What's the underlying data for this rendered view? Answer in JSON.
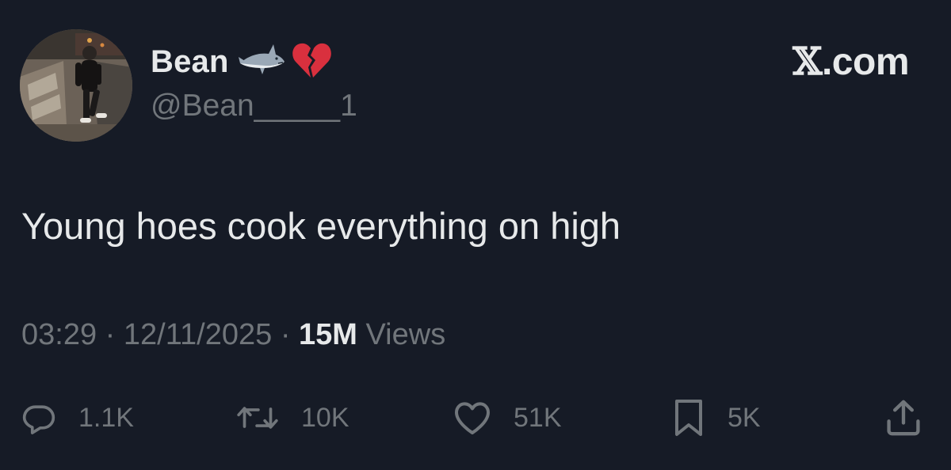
{
  "author": {
    "display_name": "Bean",
    "emojis": [
      "shark-emoji",
      "broken-heart-emoji"
    ],
    "handle": "@Bean_____1"
  },
  "brand": {
    "glyph": "𝕏",
    "suffix": ".com"
  },
  "tweet": {
    "text": "Young hoes cook everything on high"
  },
  "meta": {
    "time": "03:29",
    "date": "12/11/2025",
    "separator": "·",
    "views_count": "15M",
    "views_label": "Views"
  },
  "actions": {
    "reply": {
      "icon": "reply-icon",
      "count": "1.1K"
    },
    "repost": {
      "icon": "repost-icon",
      "count": "10K"
    },
    "like": {
      "icon": "heart-icon",
      "count": "51K"
    },
    "bookmark": {
      "icon": "bookmark-icon",
      "count": "5K"
    },
    "share": {
      "icon": "share-icon"
    }
  },
  "colors": {
    "background": "#161b26",
    "primary_text": "#e7e9ea",
    "secondary_text": "#71767b",
    "broken_heart": "#d9303e"
  }
}
